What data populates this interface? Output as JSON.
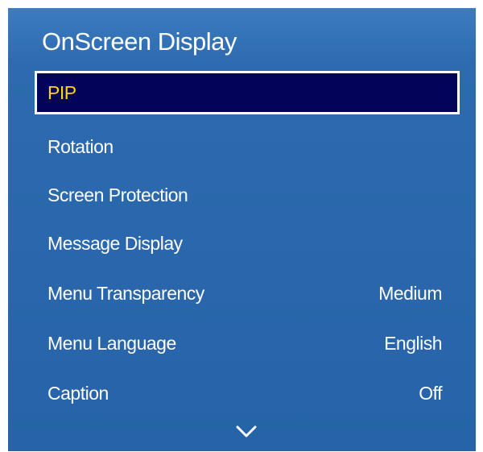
{
  "menu": {
    "title": "OnScreen Display",
    "items": [
      {
        "label": "PIP",
        "value": ""
      },
      {
        "label": "Rotation",
        "value": ""
      },
      {
        "label": "Screen Protection",
        "value": ""
      },
      {
        "label": "Message Display",
        "value": ""
      },
      {
        "label": "Menu Transparency",
        "value": "Medium"
      },
      {
        "label": "Menu Language",
        "value": "English"
      },
      {
        "label": "Caption",
        "value": "Off"
      }
    ],
    "selected_index": 0,
    "more_indicator_icon": "chevron-down-icon"
  },
  "colors": {
    "panel_background": "#2663a8",
    "selected_background": "#04035a",
    "selected_text": "#ffd700",
    "text": "#ffffff"
  }
}
